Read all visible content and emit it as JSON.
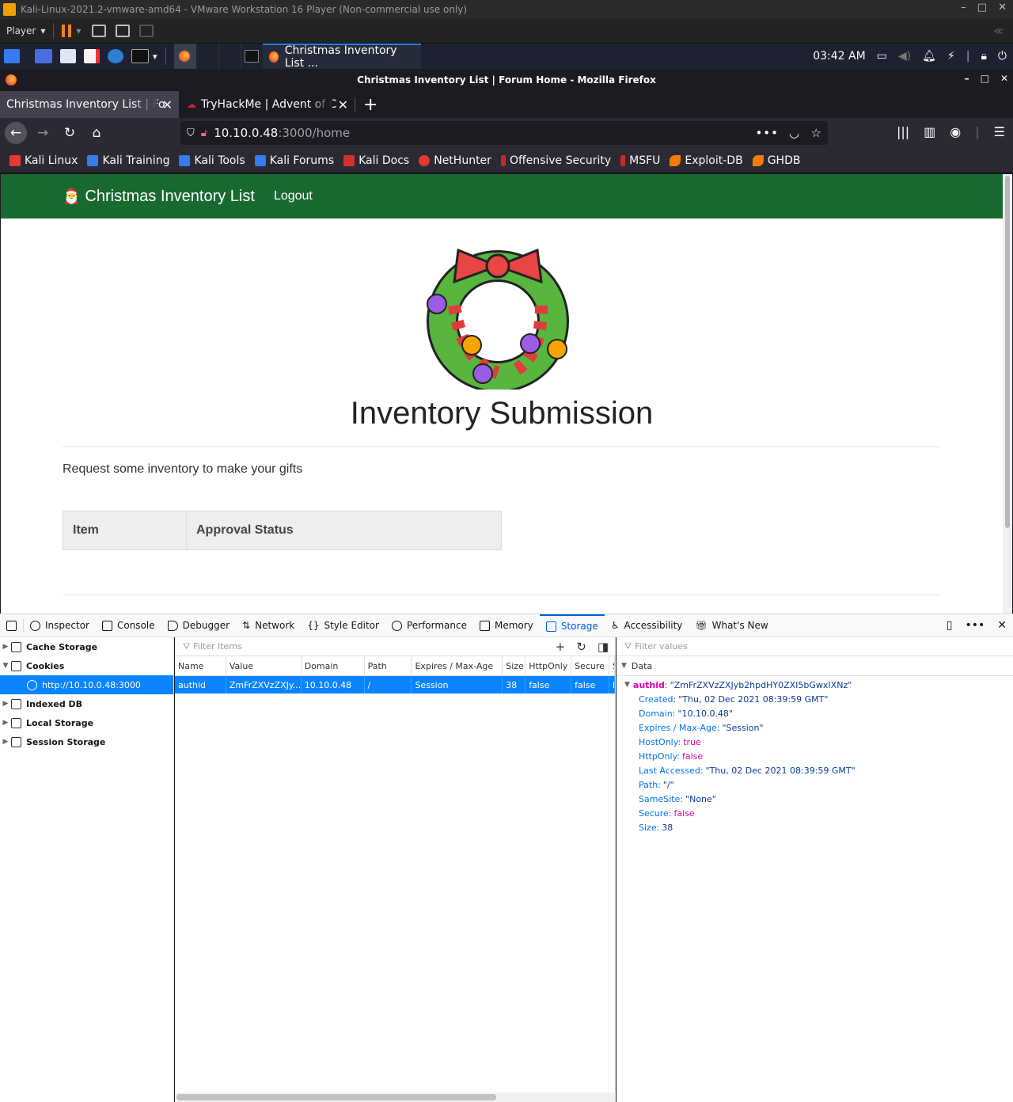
{
  "vmware": {
    "title": "Kali-Linux-2021.2-vmware-amd64 - VMware Workstation 16 Player (Non-commercial use only)",
    "player_label": "Player"
  },
  "panel": {
    "active_task": "Christmas Inventory List ...",
    "clock": "03:42 AM"
  },
  "firefox": {
    "window_title": "Christmas Inventory List | Forum Home - Mozilla Firefox",
    "tabs": [
      {
        "label": "Christmas Inventory List | Fo"
      },
      {
        "label": "TryHackMe | Advent of C"
      }
    ],
    "url_host": "10.10.0.48",
    "url_rest": ":3000/home",
    "bookmarks": [
      {
        "label": "Kali Linux",
        "color": "#e53935"
      },
      {
        "label": "Kali Training",
        "color": "#367bf0"
      },
      {
        "label": "Kali Tools",
        "color": "#367bf0"
      },
      {
        "label": "Kali Forums",
        "color": "#367bf0"
      },
      {
        "label": "Kali Docs",
        "color": "#d32f2f"
      },
      {
        "label": "NetHunter",
        "color": "#e53935"
      },
      {
        "label": "Offensive Security",
        "color": "#c62828"
      },
      {
        "label": "MSFU",
        "color": "#c62828"
      },
      {
        "label": "Exploit-DB",
        "color": "#f57c00"
      },
      {
        "label": "GHDB",
        "color": "#f57c00"
      }
    ]
  },
  "site": {
    "brand": "Christmas Inventory List",
    "logout": "Logout",
    "heading": "Inventory Submission",
    "lead": "Request some inventory to make your gifts",
    "table_headers": [
      "Item",
      "Approval Status"
    ],
    "nav_color": "#196a31"
  },
  "devtools": {
    "tools": [
      "Inspector",
      "Console",
      "Debugger",
      "Network",
      "Style Editor",
      "Performance",
      "Memory",
      "Storage",
      "Accessibility",
      "What's New"
    ],
    "selected_tool": "Storage",
    "tree": {
      "cache_storage": "Cache Storage",
      "cookies": "Cookies",
      "cookie_origin": "http://10.10.0.48:3000",
      "indexed_db": "Indexed DB",
      "local_storage": "Local Storage",
      "session_storage": "Session Storage"
    },
    "filter_items_placeholder": "Filter Items",
    "filter_values_placeholder": "Filter values",
    "columns": [
      "Name",
      "Value",
      "Domain",
      "Path",
      "Expires / Max-Age",
      "Size",
      "HttpOnly",
      "Secure",
      "S"
    ],
    "row": [
      "authid",
      "ZmFrZXVzZXJy...",
      "10.10.0.48",
      "/",
      "Session",
      "38",
      "false",
      "false",
      "N"
    ],
    "data_header": "Data",
    "cookie_name": "authid",
    "cookie_value": "\"ZmFrZXVzZXJyb2hpdHY0ZXI5bGwxIXNz\"",
    "props": [
      {
        "k": "Created:",
        "v": "\"Thu, 02 Dec 2021 08:39:59 GMT\"",
        "type": "str"
      },
      {
        "k": "Domain:",
        "v": "\"10.10.0.48\"",
        "type": "str"
      },
      {
        "k": "Expires / Max-Age:",
        "v": "\"Session\"",
        "type": "str"
      },
      {
        "k": "HostOnly:",
        "v": "true",
        "type": "bool"
      },
      {
        "k": "HttpOnly:",
        "v": "false",
        "type": "bool"
      },
      {
        "k": "Last Accessed:",
        "v": "\"Thu, 02 Dec 2021 08:39:59 GMT\"",
        "type": "str"
      },
      {
        "k": "Path:",
        "v": "\"/\"",
        "type": "str"
      },
      {
        "k": "SameSite:",
        "v": "\"None\"",
        "type": "str"
      },
      {
        "k": "Secure:",
        "v": "false",
        "type": "bool"
      },
      {
        "k": "Size:",
        "v": "38",
        "type": "str"
      }
    ]
  }
}
